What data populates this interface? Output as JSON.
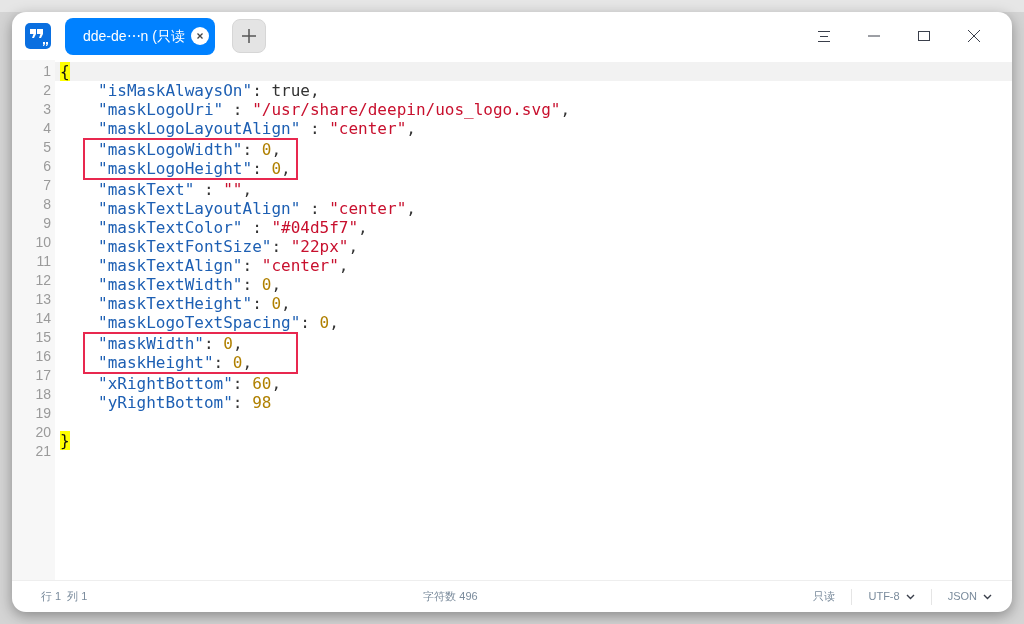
{
  "tab": {
    "title": "dde-de⋯n (只读",
    "selected": true
  },
  "editor": {
    "lines": [
      {
        "number": "1",
        "indented": false,
        "current": true,
        "boxed": false,
        "tokens": [
          {
            "kind": "brace",
            "text": "{",
            "matched": true
          }
        ]
      },
      {
        "number": "2",
        "indented": true,
        "current": false,
        "boxed": false,
        "tokens": [
          {
            "kind": "key",
            "text": "\"isMaskAlwaysOn\""
          },
          {
            "kind": "punct",
            "text": ": "
          },
          {
            "kind": "literal",
            "text": "true"
          },
          {
            "kind": "punct",
            "text": ","
          }
        ]
      },
      {
        "number": "3",
        "indented": true,
        "current": false,
        "boxed": false,
        "tokens": [
          {
            "kind": "key",
            "text": "\"maskLogoUri\""
          },
          {
            "kind": "punct",
            "text": " : "
          },
          {
            "kind": "string",
            "text": "\"/usr/share/deepin/uos_logo.svg\""
          },
          {
            "kind": "punct",
            "text": ","
          }
        ]
      },
      {
        "number": "4",
        "indented": true,
        "current": false,
        "boxed": false,
        "tokens": [
          {
            "kind": "key",
            "text": "\"maskLogoLayoutAlign\""
          },
          {
            "kind": "punct",
            "text": " : "
          },
          {
            "kind": "string",
            "text": "\"center\""
          },
          {
            "kind": "punct",
            "text": ","
          }
        ]
      },
      {
        "number": "5",
        "indented": true,
        "current": false,
        "boxed": true,
        "tokens": [
          {
            "kind": "key",
            "text": "\"maskLogoWidth\""
          },
          {
            "kind": "punct",
            "text": ": "
          },
          {
            "kind": "number",
            "text": "0"
          },
          {
            "kind": "punct",
            "text": ","
          }
        ]
      },
      {
        "number": "6",
        "indented": true,
        "current": false,
        "boxed": true,
        "tokens": [
          {
            "kind": "key",
            "text": "\"maskLogoHeight\""
          },
          {
            "kind": "punct",
            "text": ": "
          },
          {
            "kind": "number",
            "text": "0"
          },
          {
            "kind": "punct",
            "text": ","
          }
        ]
      },
      {
        "number": "7",
        "indented": true,
        "current": false,
        "boxed": false,
        "tokens": [
          {
            "kind": "key",
            "text": "\"maskText\""
          },
          {
            "kind": "punct",
            "text": " : "
          },
          {
            "kind": "string",
            "text": "\"\""
          },
          {
            "kind": "punct",
            "text": ","
          }
        ]
      },
      {
        "number": "8",
        "indented": true,
        "current": false,
        "boxed": false,
        "tokens": [
          {
            "kind": "key",
            "text": "\"maskTextLayoutAlign\""
          },
          {
            "kind": "punct",
            "text": " : "
          },
          {
            "kind": "string",
            "text": "\"center\""
          },
          {
            "kind": "punct",
            "text": ","
          }
        ]
      },
      {
        "number": "9",
        "indented": true,
        "current": false,
        "boxed": false,
        "tokens": [
          {
            "kind": "key",
            "text": "\"maskTextColor\""
          },
          {
            "kind": "punct",
            "text": " : "
          },
          {
            "kind": "string",
            "text": "\"#04d5f7\""
          },
          {
            "kind": "punct",
            "text": ","
          }
        ]
      },
      {
        "number": "10",
        "indented": true,
        "current": false,
        "boxed": false,
        "tokens": [
          {
            "kind": "key",
            "text": "\"maskTextFontSize\""
          },
          {
            "kind": "punct",
            "text": ": "
          },
          {
            "kind": "string",
            "text": "\"22px\""
          },
          {
            "kind": "punct",
            "text": ","
          }
        ]
      },
      {
        "number": "11",
        "indented": true,
        "current": false,
        "boxed": false,
        "tokens": [
          {
            "kind": "key",
            "text": "\"maskTextAlign\""
          },
          {
            "kind": "punct",
            "text": ": "
          },
          {
            "kind": "string",
            "text": "\"center\""
          },
          {
            "kind": "punct",
            "text": ","
          }
        ]
      },
      {
        "number": "12",
        "indented": true,
        "current": false,
        "boxed": false,
        "tokens": [
          {
            "kind": "key",
            "text": "\"maskTextWidth\""
          },
          {
            "kind": "punct",
            "text": ": "
          },
          {
            "kind": "number",
            "text": "0"
          },
          {
            "kind": "punct",
            "text": ","
          }
        ]
      },
      {
        "number": "13",
        "indented": true,
        "current": false,
        "boxed": false,
        "tokens": [
          {
            "kind": "key",
            "text": "\"maskTextHeight\""
          },
          {
            "kind": "punct",
            "text": ": "
          },
          {
            "kind": "number",
            "text": "0"
          },
          {
            "kind": "punct",
            "text": ","
          }
        ]
      },
      {
        "number": "14",
        "indented": true,
        "current": false,
        "boxed": false,
        "tokens": [
          {
            "kind": "key",
            "text": "\"maskLogoTextSpacing\""
          },
          {
            "kind": "punct",
            "text": ": "
          },
          {
            "kind": "number",
            "text": "0"
          },
          {
            "kind": "punct",
            "text": ","
          }
        ]
      },
      {
        "number": "15",
        "indented": true,
        "current": false,
        "boxed": true,
        "tokens": [
          {
            "kind": "key",
            "text": "\"maskWidth\""
          },
          {
            "kind": "punct",
            "text": ": "
          },
          {
            "kind": "number",
            "text": "0"
          },
          {
            "kind": "punct",
            "text": ","
          }
        ]
      },
      {
        "number": "16",
        "indented": true,
        "current": false,
        "boxed": true,
        "tokens": [
          {
            "kind": "key",
            "text": "\"maskHeight\""
          },
          {
            "kind": "punct",
            "text": ": "
          },
          {
            "kind": "number",
            "text": "0"
          },
          {
            "kind": "punct",
            "text": ","
          }
        ]
      },
      {
        "number": "17",
        "indented": true,
        "current": false,
        "boxed": false,
        "tokens": [
          {
            "kind": "key",
            "text": "\"xRightBottom\""
          },
          {
            "kind": "punct",
            "text": ": "
          },
          {
            "kind": "number",
            "text": "60"
          },
          {
            "kind": "punct",
            "text": ","
          }
        ]
      },
      {
        "number": "18",
        "indented": true,
        "current": false,
        "boxed": false,
        "tokens": [
          {
            "kind": "key",
            "text": "\"yRightBottom\""
          },
          {
            "kind": "punct",
            "text": ": "
          },
          {
            "kind": "number",
            "text": "98"
          }
        ]
      },
      {
        "number": "19"
      },
      {
        "number": "20",
        "indented": false,
        "current": false,
        "boxed": false,
        "tokens": [
          {
            "kind": "brace",
            "text": "}",
            "matched": true
          }
        ]
      },
      {
        "number": "21"
      }
    ]
  },
  "status_bar": {
    "position": "行 1  列 1",
    "char_count": "字符数 496",
    "mode": "只读",
    "encoding": "UTF-8",
    "language": "JSON"
  }
}
